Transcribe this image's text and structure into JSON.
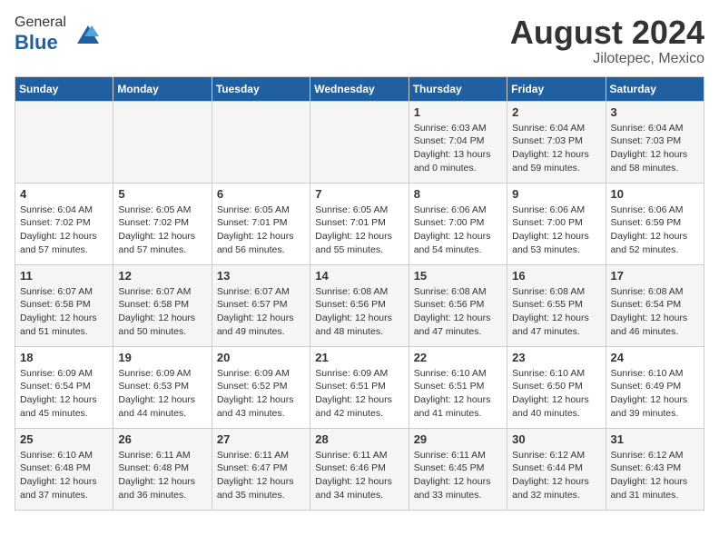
{
  "header": {
    "logo_general": "General",
    "logo_blue": "Blue",
    "month_year": "August 2024",
    "location": "Jilotepec, Mexico"
  },
  "weekdays": [
    "Sunday",
    "Monday",
    "Tuesday",
    "Wednesday",
    "Thursday",
    "Friday",
    "Saturday"
  ],
  "weeks": [
    [
      {
        "day": "",
        "info": ""
      },
      {
        "day": "",
        "info": ""
      },
      {
        "day": "",
        "info": ""
      },
      {
        "day": "",
        "info": ""
      },
      {
        "day": "1",
        "info": "Sunrise: 6:03 AM\nSunset: 7:04 PM\nDaylight: 13 hours\nand 0 minutes."
      },
      {
        "day": "2",
        "info": "Sunrise: 6:04 AM\nSunset: 7:03 PM\nDaylight: 12 hours\nand 59 minutes."
      },
      {
        "day": "3",
        "info": "Sunrise: 6:04 AM\nSunset: 7:03 PM\nDaylight: 12 hours\nand 58 minutes."
      }
    ],
    [
      {
        "day": "4",
        "info": "Sunrise: 6:04 AM\nSunset: 7:02 PM\nDaylight: 12 hours\nand 57 minutes."
      },
      {
        "day": "5",
        "info": "Sunrise: 6:05 AM\nSunset: 7:02 PM\nDaylight: 12 hours\nand 57 minutes."
      },
      {
        "day": "6",
        "info": "Sunrise: 6:05 AM\nSunset: 7:01 PM\nDaylight: 12 hours\nand 56 minutes."
      },
      {
        "day": "7",
        "info": "Sunrise: 6:05 AM\nSunset: 7:01 PM\nDaylight: 12 hours\nand 55 minutes."
      },
      {
        "day": "8",
        "info": "Sunrise: 6:06 AM\nSunset: 7:00 PM\nDaylight: 12 hours\nand 54 minutes."
      },
      {
        "day": "9",
        "info": "Sunrise: 6:06 AM\nSunset: 7:00 PM\nDaylight: 12 hours\nand 53 minutes."
      },
      {
        "day": "10",
        "info": "Sunrise: 6:06 AM\nSunset: 6:59 PM\nDaylight: 12 hours\nand 52 minutes."
      }
    ],
    [
      {
        "day": "11",
        "info": "Sunrise: 6:07 AM\nSunset: 6:58 PM\nDaylight: 12 hours\nand 51 minutes."
      },
      {
        "day": "12",
        "info": "Sunrise: 6:07 AM\nSunset: 6:58 PM\nDaylight: 12 hours\nand 50 minutes."
      },
      {
        "day": "13",
        "info": "Sunrise: 6:07 AM\nSunset: 6:57 PM\nDaylight: 12 hours\nand 49 minutes."
      },
      {
        "day": "14",
        "info": "Sunrise: 6:08 AM\nSunset: 6:56 PM\nDaylight: 12 hours\nand 48 minutes."
      },
      {
        "day": "15",
        "info": "Sunrise: 6:08 AM\nSunset: 6:56 PM\nDaylight: 12 hours\nand 47 minutes."
      },
      {
        "day": "16",
        "info": "Sunrise: 6:08 AM\nSunset: 6:55 PM\nDaylight: 12 hours\nand 47 minutes."
      },
      {
        "day": "17",
        "info": "Sunrise: 6:08 AM\nSunset: 6:54 PM\nDaylight: 12 hours\nand 46 minutes."
      }
    ],
    [
      {
        "day": "18",
        "info": "Sunrise: 6:09 AM\nSunset: 6:54 PM\nDaylight: 12 hours\nand 45 minutes."
      },
      {
        "day": "19",
        "info": "Sunrise: 6:09 AM\nSunset: 6:53 PM\nDaylight: 12 hours\nand 44 minutes."
      },
      {
        "day": "20",
        "info": "Sunrise: 6:09 AM\nSunset: 6:52 PM\nDaylight: 12 hours\nand 43 minutes."
      },
      {
        "day": "21",
        "info": "Sunrise: 6:09 AM\nSunset: 6:51 PM\nDaylight: 12 hours\nand 42 minutes."
      },
      {
        "day": "22",
        "info": "Sunrise: 6:10 AM\nSunset: 6:51 PM\nDaylight: 12 hours\nand 41 minutes."
      },
      {
        "day": "23",
        "info": "Sunrise: 6:10 AM\nSunset: 6:50 PM\nDaylight: 12 hours\nand 40 minutes."
      },
      {
        "day": "24",
        "info": "Sunrise: 6:10 AM\nSunset: 6:49 PM\nDaylight: 12 hours\nand 39 minutes."
      }
    ],
    [
      {
        "day": "25",
        "info": "Sunrise: 6:10 AM\nSunset: 6:48 PM\nDaylight: 12 hours\nand 37 minutes."
      },
      {
        "day": "26",
        "info": "Sunrise: 6:11 AM\nSunset: 6:48 PM\nDaylight: 12 hours\nand 36 minutes."
      },
      {
        "day": "27",
        "info": "Sunrise: 6:11 AM\nSunset: 6:47 PM\nDaylight: 12 hours\nand 35 minutes."
      },
      {
        "day": "28",
        "info": "Sunrise: 6:11 AM\nSunset: 6:46 PM\nDaylight: 12 hours\nand 34 minutes."
      },
      {
        "day": "29",
        "info": "Sunrise: 6:11 AM\nSunset: 6:45 PM\nDaylight: 12 hours\nand 33 minutes."
      },
      {
        "day": "30",
        "info": "Sunrise: 6:12 AM\nSunset: 6:44 PM\nDaylight: 12 hours\nand 32 minutes."
      },
      {
        "day": "31",
        "info": "Sunrise: 6:12 AM\nSunset: 6:43 PM\nDaylight: 12 hours\nand 31 minutes."
      }
    ]
  ]
}
